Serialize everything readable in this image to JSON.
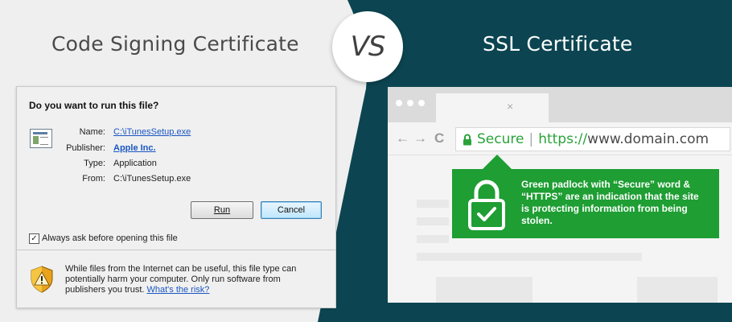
{
  "headings": {
    "left": "Code Signing Certificate",
    "vs": "VS",
    "right": "SSL Certificate"
  },
  "colors": {
    "right_bg": "#0c4551",
    "green": "#1e9e33",
    "link": "#1a56c2"
  },
  "dialog": {
    "title": "Do you want to run this file?",
    "icon": "exe-file-icon",
    "rows": [
      {
        "label": "Name:",
        "value": "C:\\iTunesSetup.exe"
      },
      {
        "label": "Publisher:",
        "value": "Apple Inc."
      },
      {
        "label": "Type:",
        "value": "Application"
      },
      {
        "label": "From:",
        "value": "C:\\iTunesSetup.exe"
      }
    ],
    "run_button": "Run",
    "cancel_button": "Cancel",
    "checkbox_label": "Always ask before opening this file",
    "checkbox_checked": "✓",
    "warning_icon": "shield-warning-icon",
    "warning_text": "While files from the Internet can be useful, this file type can potentially harm your computer. Only run software from publishers you trust.",
    "risk_link": "What's the risk?"
  },
  "browser": {
    "back": "←",
    "forward": "→",
    "reload": "C",
    "secure_label": "Secure",
    "separator": "|",
    "url_scheme": "https://",
    "url_rest": "www.domain.com",
    "tab_close": "×"
  },
  "callout": {
    "icon": "padlock-check-icon",
    "text": "Green padlock with “Secure” word & “HTTPS” are an indication that the site is protecting information from being stolen."
  }
}
